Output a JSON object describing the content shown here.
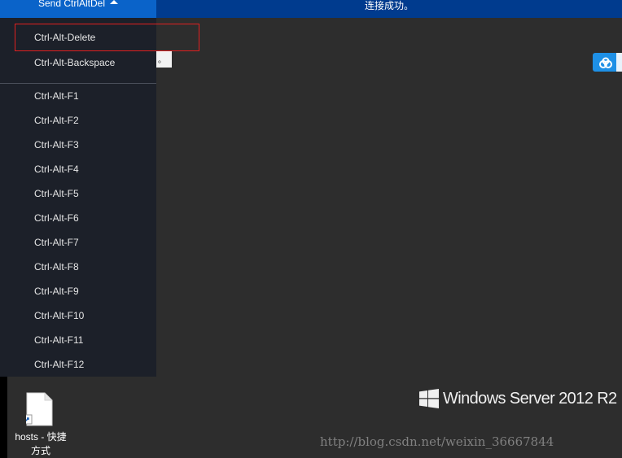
{
  "topbar": {
    "send_label": "Send CtrlAltDel",
    "status_text": "连接成功。"
  },
  "menu": {
    "items": [
      {
        "label": "Ctrl-Alt-Delete"
      },
      {
        "label": "Ctrl-Alt-Backspace"
      },
      {
        "label": "Ctrl-Alt-F1"
      },
      {
        "label": "Ctrl-Alt-F2"
      },
      {
        "label": "Ctrl-Alt-F3"
      },
      {
        "label": "Ctrl-Alt-F4"
      },
      {
        "label": "Ctrl-Alt-F5"
      },
      {
        "label": "Ctrl-Alt-F6"
      },
      {
        "label": "Ctrl-Alt-F7"
      },
      {
        "label": "Ctrl-Alt-F8"
      },
      {
        "label": "Ctrl-Alt-F9"
      },
      {
        "label": "Ctrl-Alt-F10"
      },
      {
        "label": "Ctrl-Alt-F11"
      },
      {
        "label": "Ctrl-Alt-F12"
      }
    ]
  },
  "small_box_text": "。",
  "desktop": {
    "shortcut_label_line1": "hosts - 快捷",
    "shortcut_label_line2": "方式",
    "os_brand": "Windows Server 2012 R2"
  },
  "watermark": "http://blog.csdn.net/weixin_36667844",
  "colors": {
    "desktop_bg": "#2d2d2d",
    "topbar": "#003b8e",
    "send_button": "#0a63c9",
    "menu_bg": "#1c2029",
    "highlight_border": "#e02020",
    "cloud_button": "#1e90e6"
  },
  "icons": [
    "caret-up-icon",
    "cloud-icon",
    "file-shortcut-icon",
    "windows-logo-icon"
  ]
}
